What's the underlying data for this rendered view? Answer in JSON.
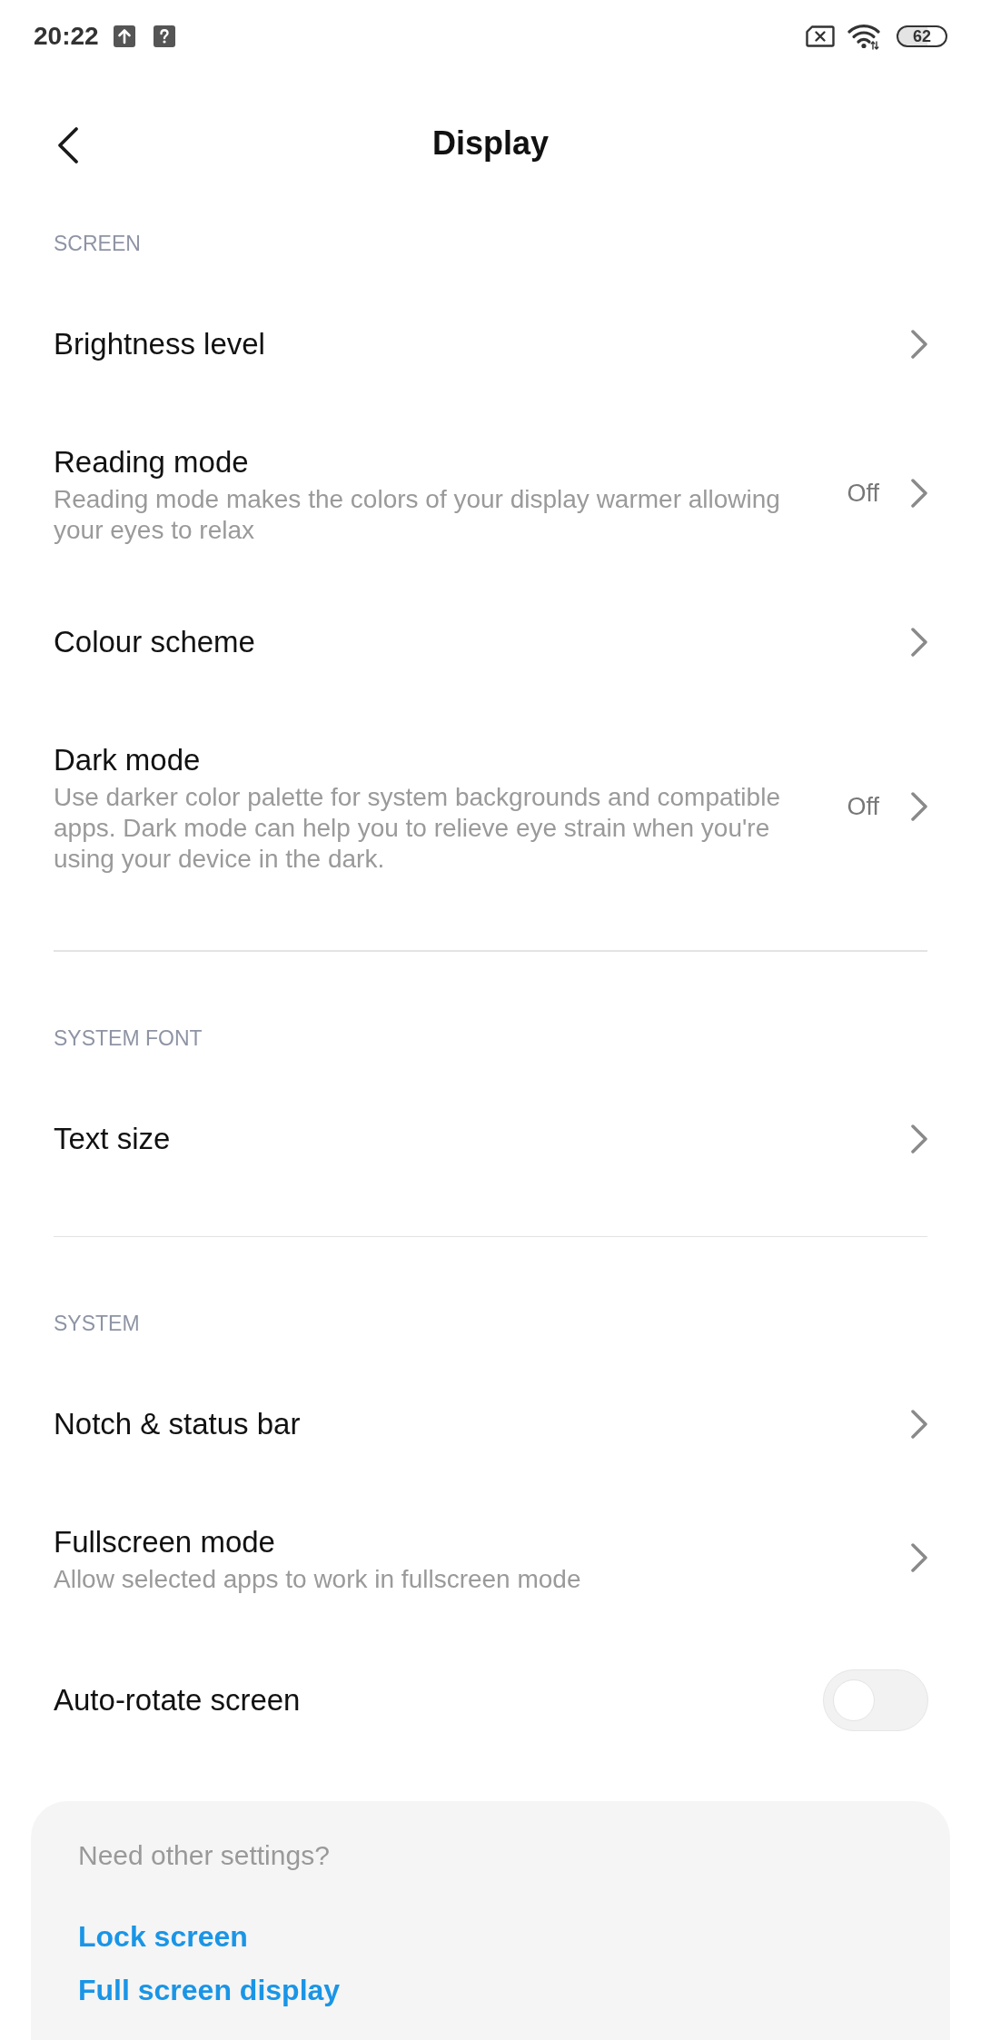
{
  "status_bar": {
    "time": "20:22",
    "battery": "62"
  },
  "header": {
    "title": "Display"
  },
  "sections": [
    {
      "title": "SCREEN",
      "items": [
        {
          "kind": "link",
          "title": "Brightness level"
        },
        {
          "kind": "link",
          "title": "Reading mode",
          "subtitle": "Reading mode makes the colors of your display warmer allowing your eyes to relax",
          "value": "Off"
        },
        {
          "kind": "link",
          "title": "Colour scheme"
        },
        {
          "kind": "link",
          "title": "Dark mode",
          "subtitle": "Use darker color palette for system backgrounds and compatible apps. Dark mode can help you to relieve eye strain when you're using your device in the dark.",
          "value": "Off"
        }
      ]
    },
    {
      "title": "SYSTEM FONT",
      "items": [
        {
          "kind": "link",
          "title": "Text size"
        }
      ]
    },
    {
      "title": "SYSTEM",
      "items": [
        {
          "kind": "link",
          "title": "Notch & status bar"
        },
        {
          "kind": "link",
          "title": "Fullscreen mode",
          "subtitle": "Allow selected apps to work in fullscreen mode"
        },
        {
          "kind": "toggle",
          "title": "Auto-rotate screen",
          "on": false
        }
      ]
    }
  ],
  "other_settings": {
    "title": "Need other settings?",
    "links": [
      "Lock screen",
      "Full screen display"
    ]
  }
}
